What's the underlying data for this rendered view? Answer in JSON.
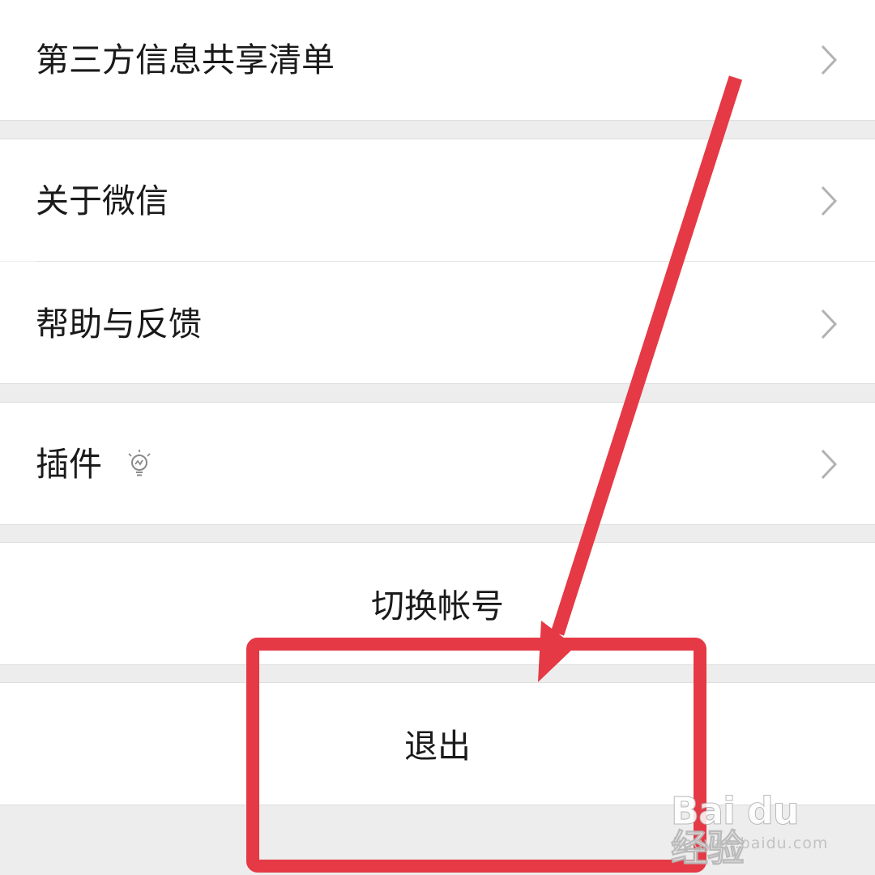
{
  "settings": {
    "items": [
      {
        "label": "第三方信息共享清单",
        "icon": "chevron-right-icon"
      },
      {
        "label": "关于微信",
        "icon": "chevron-right-icon"
      },
      {
        "label": "帮助与反馈",
        "icon": "chevron-right-icon"
      },
      {
        "label": "插件",
        "badge_icon": "lightbulb-icon",
        "icon": "chevron-right-icon"
      }
    ],
    "switch_account": "切换帐号",
    "logout": "退出"
  },
  "annotation": {
    "arrow_color": "#e53945",
    "highlight_color": "#e53945",
    "target": "logout"
  },
  "watermark": {
    "logo": "Bai du 经验",
    "url": "jingyan.baidu.com"
  },
  "colors": {
    "background": "#ededed",
    "row": "#ffffff",
    "text": "#1a1a1a",
    "chevron": "#b2b2b2"
  }
}
